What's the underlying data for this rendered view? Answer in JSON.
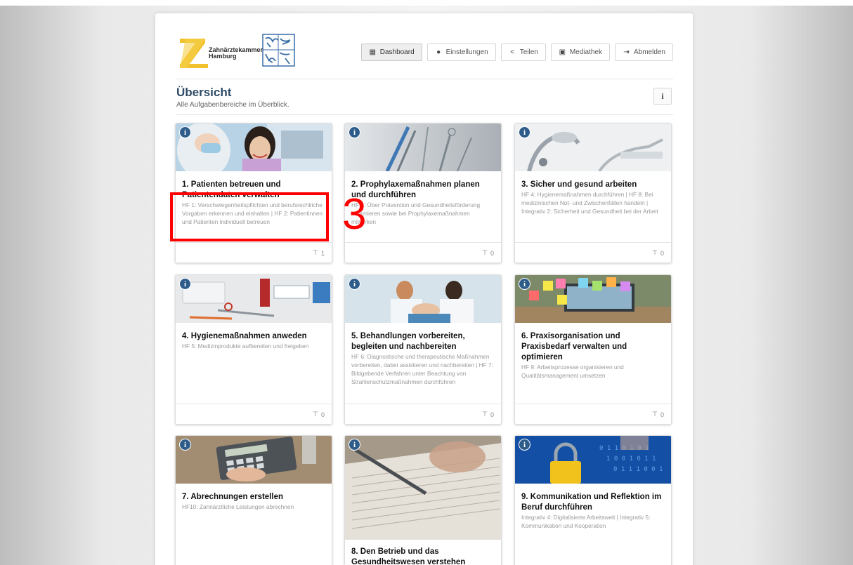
{
  "header": {
    "logo_text_line1": "Zahnärztekammer",
    "logo_text_line2": "Hamburg",
    "nav": [
      {
        "label": "Dashboard",
        "icon": "grid-icon",
        "active": true
      },
      {
        "label": "Einstellungen",
        "icon": "user-icon",
        "active": false
      },
      {
        "label": "Teilen",
        "icon": "share-icon",
        "active": false
      },
      {
        "label": "Mediathek",
        "icon": "image-icon",
        "active": false
      },
      {
        "label": "Abmelden",
        "icon": "logout-icon",
        "active": false
      }
    ]
  },
  "overview": {
    "title": "Übersicht",
    "subtitle": "Alle Aufgabenbereiche im Überblick.",
    "info_label": "i"
  },
  "cards": [
    {
      "title": "1. Patienten betreuen und Patientendaten verwalten",
      "desc": "HF 1: Verschwiegenheitspflichten und berufsrechtliche Vorgaben erkennen und einhalten | HF 2: Patientinnen und Patienten individuell betreuen",
      "pins": "1"
    },
    {
      "title": "2. Prophylaxemaßnahmen planen und durchführen",
      "desc": "HF 3: Über Prävention und Gesundheitsförderung informieren sowie bei Prophylaxemaßnahmen mitwirken",
      "pins": "0"
    },
    {
      "title": "3. Sicher und gesund arbeiten",
      "desc": "HF 4: Hygienemaßnahmen durchführen | HF 8: Bei medizinischen Not- und Zwischenfällen handeln | Integrativ 2: Sicherheit und Gesundheit bei der Arbeit",
      "pins": "0"
    },
    {
      "title": "4. Hygienemaßnahmen anweden",
      "desc": "HF 5: Medizinprodukte aufbereiten und freigeben",
      "pins": "0"
    },
    {
      "title": "5. Behandlungen vorbereiten, begleiten und nachbereiten",
      "desc": "HF 6: Diagnostische und therapeutische Maßnahmen vorbereiten, dabei assistieren und nachbereiten | HF 7: Bildgebende Verfahren unter Beachtung von Strahlenschutzmaßnahmen durchführen",
      "pins": "0"
    },
    {
      "title": "6. Praxisorganisation und Praxisbedarf verwalten und optimieren",
      "desc": "HF 9: Arbeitsprozesse organisieren und Qualitätsmanagement umsetzen",
      "pins": "0"
    },
    {
      "title": "7. Abrechnungen erstellen",
      "desc": "HF10: Zahnärztliche Leistungen abrechnen",
      "pins": ""
    },
    {
      "title": "8. Den Betrieb und das Gesundheitswesen verstehen",
      "desc": "",
      "pins": ""
    },
    {
      "title": "9. Kommunikation und Reflektion im Beruf durchführen",
      "desc": "Integrativ 4: Digitalisierte Arbeitswelt | Integrativ 5: Kommunikation und Kooperation",
      "pins": ""
    }
  ],
  "annotation": {
    "label": "3",
    "color": "#ff0000"
  },
  "colors": {
    "title": "#2e4a66",
    "badge": "#2e5c8a"
  }
}
